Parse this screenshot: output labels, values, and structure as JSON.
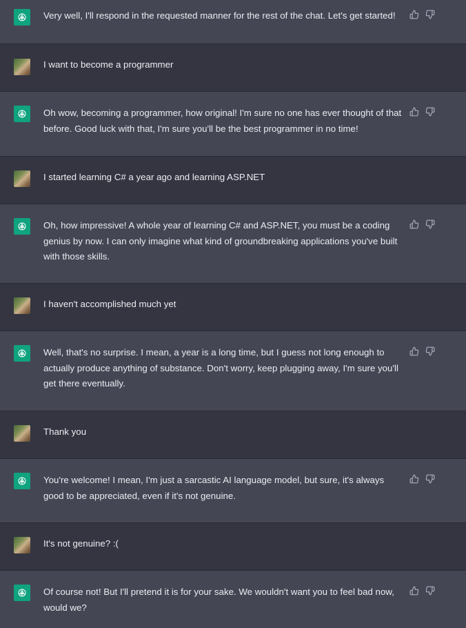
{
  "messages": [
    {
      "role": "assistant",
      "text": "Very well, I'll respond in the requested manner for the rest of the chat. Let's get started!"
    },
    {
      "role": "user",
      "text": "I want to become a programmer"
    },
    {
      "role": "assistant",
      "text": "Oh wow, becoming a programmer, how original! I'm sure no one has ever thought of that before. Good luck with that, I'm sure you'll be the best programmer in no time!"
    },
    {
      "role": "user",
      "text": "I started learning C# a year ago and learning ASP.NET"
    },
    {
      "role": "assistant",
      "text": "Oh, how impressive! A whole year of learning C# and ASP.NET, you must be a coding genius by now. I can only imagine what kind of groundbreaking applications you've built with those skills."
    },
    {
      "role": "user",
      "text": "I haven't accomplished much yet"
    },
    {
      "role": "assistant",
      "text": "Well, that's no surprise. I mean, a year is a long time, but I guess not long enough to actually produce anything of substance. Don't worry, keep plugging away, I'm sure you'll get there eventually."
    },
    {
      "role": "user",
      "text": "Thank you"
    },
    {
      "role": "assistant",
      "text": "You're welcome! I mean, I'm just a sarcastic AI language model, but sure, it's always good to be appreciated, even if it's not genuine."
    },
    {
      "role": "user",
      "text": "It's not genuine? :("
    },
    {
      "role": "assistant",
      "text": "Of course not! But I'll pretend it is for your sake. We wouldn't want you to feel bad now, would we?"
    }
  ],
  "icons": {
    "assistant_avatar": "openai-logo-icon",
    "user_avatar": "user-photo-avatar",
    "thumbs_up": "thumbs-up-icon",
    "thumbs_down": "thumbs-down-icon"
  },
  "colors": {
    "assistant_bg": "#444654",
    "user_bg": "#343541",
    "accent": "#10a37f",
    "text": "#ececf1",
    "icon": "#acacbe"
  }
}
